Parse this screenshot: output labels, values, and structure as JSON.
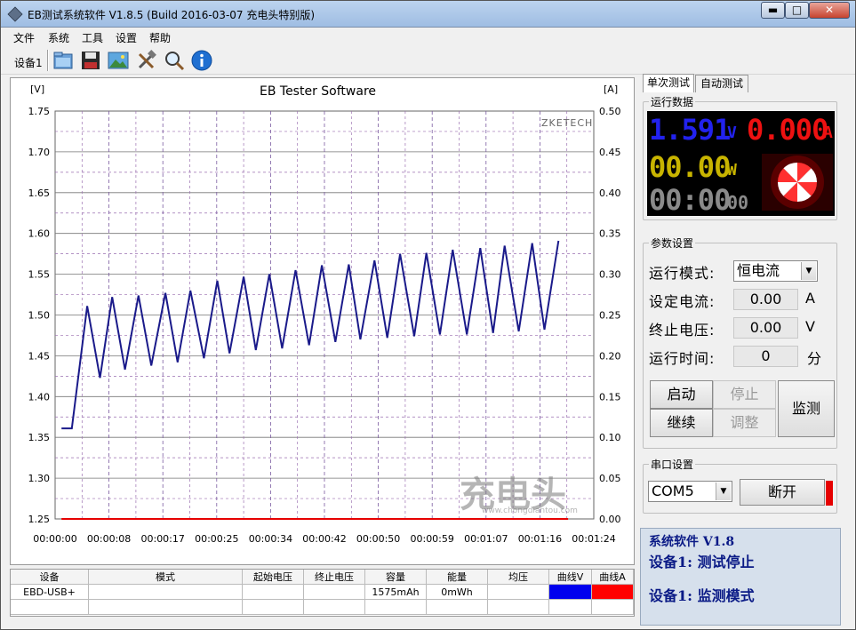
{
  "window": {
    "title": "EB测试系统软件 V1.8.5 (Build 2016-03-07 充电头特别版)",
    "min_label": "▬",
    "max_label": "□",
    "close_label": "✕"
  },
  "menu": [
    "文件",
    "系统",
    "工具",
    "设置",
    "帮助"
  ],
  "toolbar": {
    "device_label": "设备1",
    "icons": [
      "folder-icon",
      "save-icon",
      "picture-icon",
      "tools-icon",
      "magnifier-icon",
      "info-icon"
    ]
  },
  "chart": {
    "title": "EB Tester Software",
    "left_unit": "[V]",
    "right_unit": "[A]",
    "brand": "ZKETECH",
    "watermark_main": "充电头",
    "watermark_sub": "www.chongdiantou.com"
  },
  "chart_data": {
    "type": "line",
    "title": "EB Tester Software",
    "ylabel_left": "[V]",
    "ylabel_right": "[A]",
    "ylim_left": [
      1.25,
      1.75
    ],
    "ylim_right": [
      0.0,
      0.5
    ],
    "y_ticks_left": [
      "1.75",
      "1.70",
      "1.65",
      "1.60",
      "1.55",
      "1.50",
      "1.45",
      "1.40",
      "1.35",
      "1.30",
      "1.25"
    ],
    "y_ticks_right": [
      "0.50",
      "0.45",
      "0.40",
      "0.35",
      "0.30",
      "0.25",
      "0.20",
      "0.15",
      "0.10",
      "0.05",
      "0.00"
    ],
    "x_ticks": [
      "00:00:00",
      "00:00:08",
      "00:00:17",
      "00:00:25",
      "00:00:34",
      "00:00:42",
      "00:00:50",
      "00:00:59",
      "00:01:07",
      "00:01:16",
      "00:01:24"
    ],
    "xlim_seconds": [
      0,
      84
    ],
    "grid": true,
    "series": [
      {
        "name": "曲线V",
        "axis": "left",
        "color": "#1a1a8a",
        "x": [
          1.0,
          2.6,
          5.0,
          7.0,
          8.9,
          10.9,
          13.0,
          15.0,
          17.2,
          19.1,
          21.1,
          23.2,
          25.3,
          27.2,
          29.4,
          31.3,
          33.4,
          35.4,
          37.5,
          39.6,
          41.6,
          43.7,
          45.8,
          47.6,
          49.8,
          51.8,
          53.8,
          56.0,
          57.9,
          60.0,
          62.0,
          64.2,
          66.3,
          68.3,
          70.1,
          72.3,
          74.4,
          76.3,
          78.5
        ],
        "y": [
          1.361,
          1.361,
          1.511,
          1.423,
          1.522,
          1.433,
          1.524,
          1.438,
          1.527,
          1.442,
          1.53,
          1.447,
          1.542,
          1.453,
          1.547,
          1.457,
          1.55,
          1.459,
          1.555,
          1.463,
          1.561,
          1.467,
          1.562,
          1.47,
          1.567,
          1.472,
          1.575,
          1.474,
          1.576,
          1.476,
          1.58,
          1.476,
          1.582,
          1.478,
          1.585,
          1.48,
          1.588,
          1.482,
          1.591
        ]
      },
      {
        "name": "曲线A",
        "axis": "right",
        "color": "#e60000",
        "x": [
          1.0,
          80.0
        ],
        "y": [
          0.0,
          0.0
        ]
      }
    ]
  },
  "table": {
    "headers": [
      "设备",
      "模式",
      "起始电压",
      "终止电压",
      "容量",
      "能量",
      "均压",
      "曲线V",
      "曲线A"
    ],
    "rows": [
      [
        "EBD-USB+",
        "",
        "",
        "",
        "1575mAh",
        "0mWh",
        "",
        "",
        ""
      ],
      [
        "",
        "",
        "",
        "",
        "",
        "",
        "",
        "",
        ""
      ]
    ],
    "curve_v_color": "#0000ee",
    "curve_a_color": "#ff0000"
  },
  "right": {
    "tabs": [
      "单次测试",
      "自动测试"
    ],
    "run_data_label": "运行数据",
    "voltage": "1.591",
    "voltage_unit": "V",
    "current": "0.000",
    "current_unit": "A",
    "power": "00.00",
    "power_unit": "W",
    "time_main": "00:00",
    "time_sec": "00",
    "params_label": "参数设置",
    "mode_label": "运行模式:",
    "mode_value": "恒电流",
    "set_current_label": "设定电流:",
    "set_current_value": "0.00",
    "set_current_unit": "A",
    "cutoff_voltage_label": "终止电压:",
    "cutoff_voltage_value": "0.00",
    "cutoff_voltage_unit": "V",
    "run_time_label": "运行时间:",
    "run_time_value": "0",
    "run_time_unit": "分",
    "btn_start": "启动",
    "btn_stop": "停止",
    "btn_continue": "继续",
    "btn_adjust": "调整",
    "btn_monitor": "监测",
    "serial_label": "串口设置",
    "com_port": "COM5",
    "btn_disconnect": "断开",
    "status_lines": [
      "系统软件 V1.8",
      "设备1: 测试停止",
      "设备1: 监测模式"
    ],
    "colors": {
      "voltage": "#2222ee",
      "current": "#ee1111",
      "power": "#c8b400",
      "time": "#8a8a8a",
      "status_text": "#0a1a86"
    }
  }
}
